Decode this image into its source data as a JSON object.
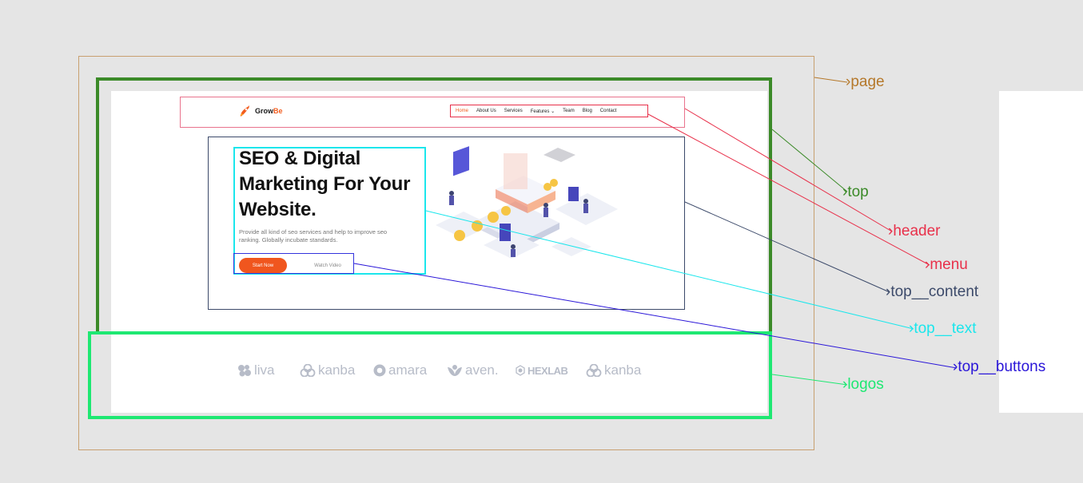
{
  "header": {
    "logo": {
      "text_main": "Grow",
      "text_accent": "Be",
      "accent": "#f25c1e"
    },
    "menu": [
      {
        "label": "Home",
        "active": true
      },
      {
        "label": "About Us"
      },
      {
        "label": "Services"
      },
      {
        "label": "Features ⌄"
      },
      {
        "label": "Team"
      },
      {
        "label": "Blog"
      },
      {
        "label": "Contact"
      }
    ]
  },
  "hero": {
    "title_line1": "SEO & Digital",
    "title_line2": "Marketing For Your",
    "title_line3": "Website.",
    "description": "Provide all kind of seo services and help to improve seo ranking. Globally incubate standards.",
    "start_label": "Start Now",
    "watch_label": "Watch Video",
    "illustration_icon": "isometric-seo-illustration"
  },
  "logos": [
    "liva",
    "kanba",
    "amara",
    "aven.",
    "HEXLAB",
    "kanba"
  ],
  "annotations": {
    "page": "page",
    "top": "top",
    "header": "header",
    "menu": "menu",
    "top_content": "top__content",
    "top_text": "top__text",
    "top_buttons": "top__buttons",
    "logos": "logos"
  },
  "colors": {
    "page": "#b5782a",
    "top": "#3b8a28",
    "header": "#e8304a",
    "menu": "#e8304a",
    "top_content": "#3c4a6a",
    "top_text": "#1be6ec",
    "top_buttons": "#2a16d8",
    "logos": "#1ee872"
  }
}
